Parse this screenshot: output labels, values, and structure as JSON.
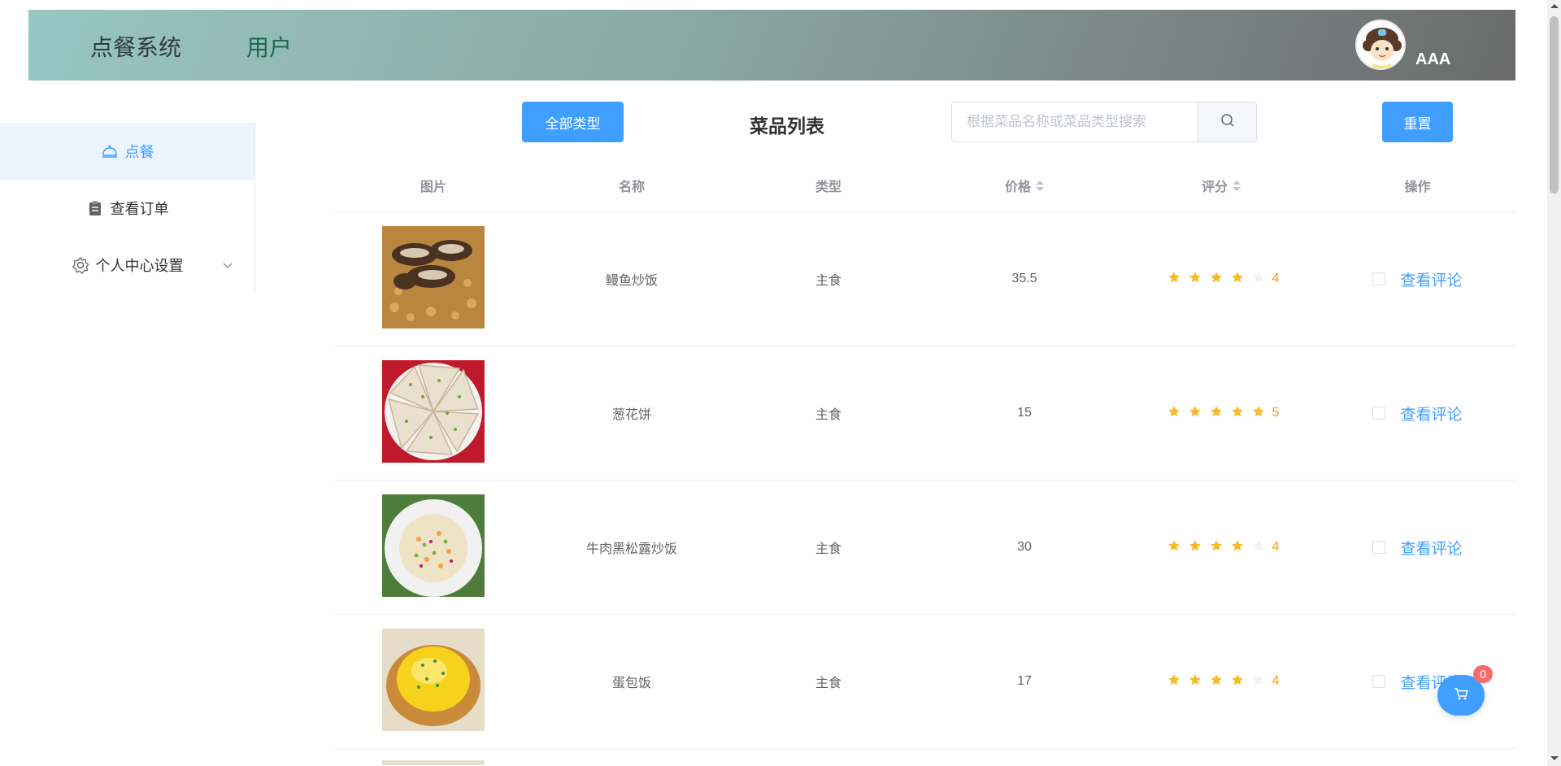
{
  "header": {
    "brand": "点餐系统",
    "role": "用户",
    "username": "AAA"
  },
  "sidebar": {
    "items": [
      {
        "label": "点餐",
        "icon": "bell-dish-icon",
        "active": true
      },
      {
        "label": "查看订单",
        "icon": "clipboard-icon",
        "active": false
      },
      {
        "label": "个人中心设置",
        "icon": "gear-icon",
        "active": false,
        "has_submenu": true
      }
    ]
  },
  "toolbar": {
    "type_filter_label": "全部类型",
    "title": "菜品列表",
    "search_placeholder": "根据菜品名称或菜品类型搜索",
    "reset_label": "重置"
  },
  "table": {
    "columns": [
      "图片",
      "名称",
      "类型",
      "价格",
      "评分",
      "操作"
    ],
    "sortable": [
      "价格",
      "评分"
    ],
    "rows": [
      {
        "name": "鳗鱼炒饭",
        "type": "主食",
        "price": "35.5",
        "rating": 4,
        "action": "查看评论",
        "image": "eel-fried-rice"
      },
      {
        "name": "葱花饼",
        "type": "主食",
        "price": "15",
        "rating": 5,
        "action": "查看评论",
        "image": "scallion-pancake"
      },
      {
        "name": "牛肉黑松露炒饭",
        "type": "主食",
        "price": "30",
        "rating": 4,
        "action": "查看评论",
        "image": "beef-truffle-fried-rice"
      },
      {
        "name": "蛋包饭",
        "type": "主食",
        "price": "17",
        "rating": 4,
        "action": "查看评论",
        "image": "omurice"
      }
    ]
  },
  "cart": {
    "count": "0",
    "icon": "cart-icon"
  },
  "colors": {
    "primary": "#409eff",
    "star": "#f7ba2a",
    "score": "#ff9900",
    "badge": "#f56c6c"
  }
}
